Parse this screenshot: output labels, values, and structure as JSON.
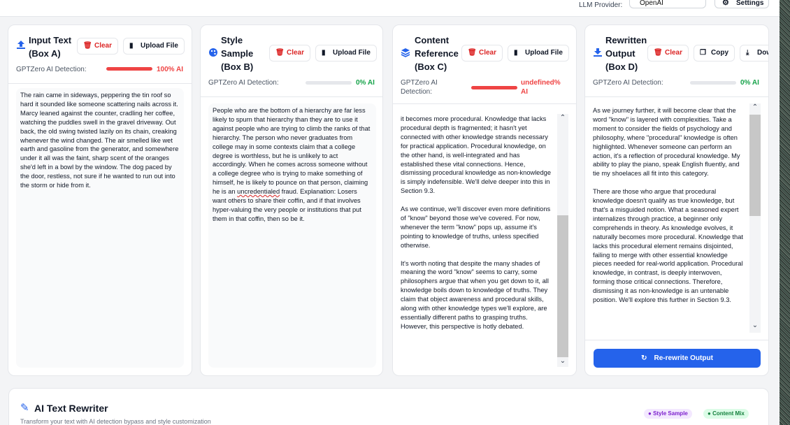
{
  "topbar": {
    "llm_label": "LLM Provider:",
    "llm_value": "OpenAI",
    "settings_label": "Settings"
  },
  "panels": {
    "a": {
      "title_line1": "Input Text",
      "title_line2": "(Box A)",
      "clear": "Clear",
      "upload": "Upload File",
      "det_label": "GPTZero AI Detection:",
      "det_value": "100% AI",
      "det_fraction": 1.0,
      "det_color": "#ef4444",
      "text": "The rain came in sideways, peppering the tin roof so hard it sounded like someone scattering nails across it. Marcy leaned against the counter, cradling her coffee, watching the puddles swell in the gravel driveway. Out back, the old swing twisted lazily on its chain, creaking whenever the wind changed. The air smelled like wet earth and gasoline from the generator, and somewhere under it all was the faint, sharp scent of the oranges she'd left in a bowl by the window. The dog paced by the door, restless, not sure if he wanted to run out into the storm or hide from it."
    },
    "b": {
      "title_line1": "Style",
      "title_line2": "Sample",
      "title_line3": "(Box B)",
      "clear": "Clear",
      "upload": "Upload File",
      "det_label": "GPTZero AI Detection:",
      "det_value": "0% AI",
      "det_fraction": 0.0,
      "det_color": "#16a34a",
      "text_pre": "People who are the bottom of a hierarchy are far less likely to spurn that hierarchy than they are to use it against people who are trying to climb the ranks of that hierarchy. The person who never graduates from college may in some contexts claim that a college degree is worthless, but he is unlikely to act accordingly. When he comes across someone without a college degree who is trying to make something of himself, he is likely to pounce on that person, claiming he is an ",
      "text_squiggle": "uncredentialed",
      "text_post": " fraud. Explanation: Losers want others to share their coffin, and if that involves hyper-valuing the very people or institutions that put them in that coffin, then so be it."
    },
    "c": {
      "title_line1": "Content",
      "title_line2": "Reference",
      "title_line3": "(Box C)",
      "clear": "Clear",
      "upload": "Upload File",
      "det_label_line1": "GPTZero AI",
      "det_label_line2": "Detection:",
      "det_value_line1": "undefined%",
      "det_value_line2": "AI",
      "det_color": "#ef4444",
      "text": "it becomes more procedural. Knowledge that lacks procedural depth is fragmented; it hasn't yet connected with other knowledge strands necessary for practical application. Procedural knowledge, on the other hand, is well-integrated and has established these vital connections. Hence, dismissing procedural knowledge as non-knowledge is simply indefensible. We'll delve deeper into this in Section 9.3.\n\nAs we continue, we'll discover even more definitions of \"know\" beyond those we've covered. For now, whenever the term \"know\" pops up, assume it's pointing to knowledge of truths, unless specified otherwise.\n\nIt's worth noting that despite the many shades of meaning the word \"know\" seems to carry, some philosophers argue that when you get down to it, all knowledge boils down to knowledge of truths. They claim that object awareness and procedural skills, along with other knowledge types we'll explore, are essentially different paths to grasping truths. However, this perspective is hotly debated."
    },
    "d": {
      "title_line1": "Rewritten",
      "title_line2": "Output",
      "title_line3": "(Box D)",
      "clear": "Clear",
      "copy": "Copy",
      "download": "Download",
      "det_label": "GPTZero AI Detection:",
      "det_value": "0% AI",
      "det_fraction": 0.0,
      "det_color": "#16a34a",
      "text": "As we journey further, it will become clear that the word \"know\" is layered with complexities. Take a moment to consider the fields of psychology and philosophy, where \"procedural\" knowledge is often highlighted. Whenever someone can perform an action, it's a reflection of procedural knowledge. My ability to play the piano, speak English fluently, and tie my shoelaces all fit into this category.\n\nThere are those who argue that procedural knowledge doesn't qualify as true knowledge, but that's a misguided notion. What a seasoned expert internalizes through practice, a beginner only comprehends in theory. As knowledge evolves, it naturally becomes more procedural. Knowledge that lacks this procedural element remains disjointed, failing to merge with other essential knowledge pieces needed for real-world application. Procedural knowledge, in contrast, is deeply interwoven, forming those critical connections. Therefore, dismissing it as non-knowledge is an untenable position. We'll explore this further in Section 9.3.",
      "rewrite": "Re-rewrite Output"
    }
  },
  "footer": {
    "title": "AI Text Rewriter",
    "subtitle": "Transform your text with AI detection bypass and style customization",
    "badge_style": "Style Sample",
    "badge_content": "Content Mix"
  },
  "icons": {
    "upload": "upload-icon",
    "palette": "palette-icon",
    "layers": "layers-icon",
    "download": "download-icon",
    "trash": "trash-icon",
    "file": "file-icon",
    "copy": "copy-icon",
    "refresh": "refresh-icon",
    "pencil": "pencil-icon",
    "gear": "gear-icon"
  }
}
